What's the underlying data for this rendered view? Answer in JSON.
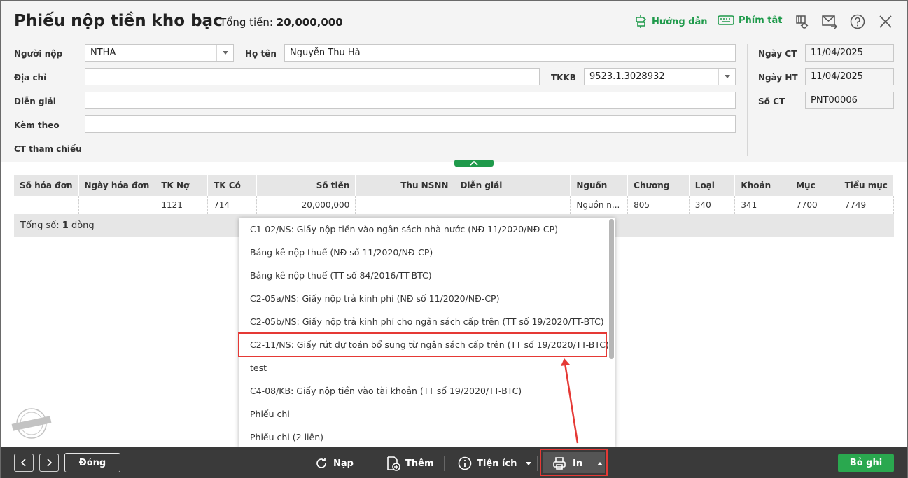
{
  "window": {
    "title": "Phiếu nộp tiền kho bạc",
    "total_label": "Tổng tiền:",
    "total_value": "20,000,000"
  },
  "toplinks": {
    "guide": "Hướng dẫn",
    "shortcuts": "Phím tắt"
  },
  "form": {
    "payer_label": "Người nộp",
    "payer_value": "NTHA",
    "name_label": "Họ tên",
    "name_value": "Nguyễn Thu Hà",
    "address_label": "Địa chỉ",
    "address_value": "",
    "tkkb_label": "TKKB",
    "tkkb_value": "9523.1.3028932",
    "desc_label": "Diễn giải",
    "desc_value": "",
    "attach_label": "Kèm theo",
    "attach_value": "",
    "ref_label": "CT tham chiếu",
    "date_ct_label": "Ngày CT",
    "date_ct_value": "11/04/2025",
    "date_ht_label": "Ngày HT",
    "date_ht_value": "11/04/2025",
    "so_ct_label": "Số CT",
    "so_ct_value": "PNT00006"
  },
  "grid": {
    "columns": [
      "Số hóa đơn",
      "Ngày hóa đơn",
      "TK Nợ",
      "TK Có",
      "Số tiền",
      "Thu NSNN",
      "Diễn giải",
      "Nguồn",
      "Chương",
      "Loại",
      "Khoản",
      "Mục",
      "Tiểu mục"
    ],
    "row": [
      "",
      "",
      "1121",
      "714",
      "20,000,000",
      "",
      "",
      "Nguồn n...",
      "805",
      "340",
      "341",
      "7700",
      "7749"
    ],
    "summary_prefix": "Tổng số:",
    "summary_count": "1",
    "summary_suffix": "dòng"
  },
  "menu": {
    "items": [
      "C1-02/NS: Giấy nộp tiền vào ngân sách nhà nước (NĐ 11/2020/NĐ-CP)",
      "Bảng kê nộp thuế (NĐ số 11/2020/NĐ-CP)",
      "Bảng kê nộp thuế (TT số 84/2016/TT-BTC)",
      "C2-05a/NS: Giấy nộp trả kinh phí (NĐ số 11/2020/NĐ-CP)",
      "C2-05b/NS: Giấy nộp trả kinh phí cho ngân sách cấp trên (TT số 19/2020/TT-BTC)",
      "C2-11/NS: Giấy rút dự toán bổ sung từ ngân sách cấp trên (TT số 19/2020/TT-BTC)",
      "test",
      "C4-08/KB: Giấy nộp tiền vào tài khoản (TT số 19/2020/TT-BTC)",
      "Phiếu chi",
      "Phiếu chi (2 liên)"
    ]
  },
  "footer": {
    "close": "Đóng",
    "reload": "Nạp",
    "add": "Thêm",
    "utilities": "Tiện ích",
    "print": "In",
    "save": "Bỏ ghi"
  },
  "colors": {
    "accent": "#1f9a4b",
    "footer_bg": "#3a3a3a",
    "highlight": "#e53935"
  }
}
